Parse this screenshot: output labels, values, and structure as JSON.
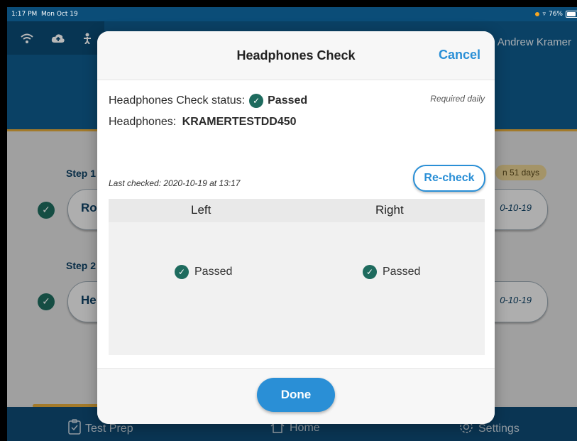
{
  "status_bar": {
    "time": "1:17 PM",
    "date": "Mon Oct 19",
    "battery": "76%"
  },
  "header": {
    "user_name": "Andrew Kramer"
  },
  "background": {
    "step1_label": "Step 1",
    "step1_button": "Ro",
    "step1_date": "0-10-19",
    "step1_badge": "n 51 days",
    "step2_label": "Step 2",
    "step2_button": "He",
    "step2_date": "0-10-19"
  },
  "tabs": [
    {
      "label": "Test Prep",
      "icon": "clipboard-check-icon"
    },
    {
      "label": "Home",
      "icon": "home-icon"
    },
    {
      "label": "Settings",
      "icon": "gear-icon"
    }
  ],
  "modal": {
    "title": "Headphones Check",
    "cancel_label": "Cancel",
    "status_label": "Headphones Check status:",
    "status_value": "Passed",
    "required_text": "Required daily",
    "headphones_label": "Headphones:",
    "headphones_value": "KRAMERTESTDD450",
    "last_checked": "Last checked: 2020-10-19 at 13:17",
    "recheck_label": "Re-check",
    "columns": [
      "Left",
      "Right"
    ],
    "results": [
      "Passed",
      "Passed"
    ],
    "done_label": "Done"
  },
  "colors": {
    "primary": "#0f5a8c",
    "accent": "#2a8fd6",
    "success": "#1e6b5e",
    "highlight": "#e2a93b"
  }
}
